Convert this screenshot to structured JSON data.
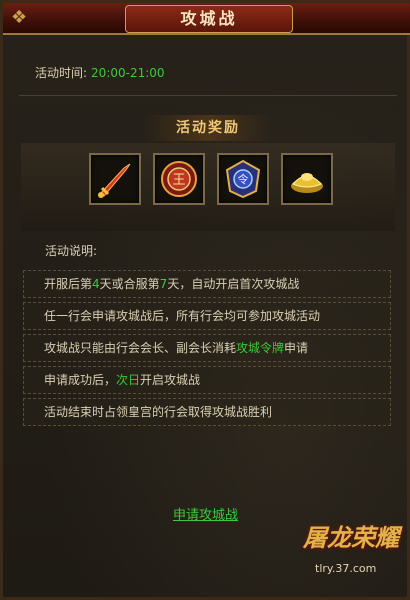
{
  "window": {
    "title": "攻城战"
  },
  "activity_time": {
    "label": "活动时间:",
    "value": "20:00-21:00"
  },
  "rewards": {
    "title": "活动奖励",
    "items": [
      {
        "icon": "sword-icon",
        "color": "#d43a1a"
      },
      {
        "icon": "king-medal-icon",
        "color": "#c0361e"
      },
      {
        "icon": "guild-badge-icon",
        "color": "#3a4fb8"
      },
      {
        "icon": "gold-ingot-icon",
        "color": "#e8c030"
      }
    ]
  },
  "description": {
    "label": "活动说明:",
    "rules": [
      {
        "p1": "开服后第",
        "h1": "4",
        "p2": "天或合服第",
        "h2": "7",
        "p3": "天，自动开启首次攻城战"
      },
      {
        "p1": "任一行会申请攻城战后，所有行会均可参加攻城活动"
      },
      {
        "p1": "攻城战只能由行会会长、副会长消耗",
        "h1": "攻城令牌",
        "p2": "申请"
      },
      {
        "p1": "申请成功后，",
        "h1": "次日",
        "p2": "开启攻城战"
      },
      {
        "p1": "活动结束时占领皇宫的行会取得攻城战胜利"
      }
    ]
  },
  "apply_link": "申请攻城战",
  "logo": {
    "main": "屠龙荣耀",
    "url": "tlry.37.com"
  },
  "colors": {
    "highlight": "#3ec83a",
    "title_text": "#f6e6c0",
    "frame": "#3a2a17"
  }
}
